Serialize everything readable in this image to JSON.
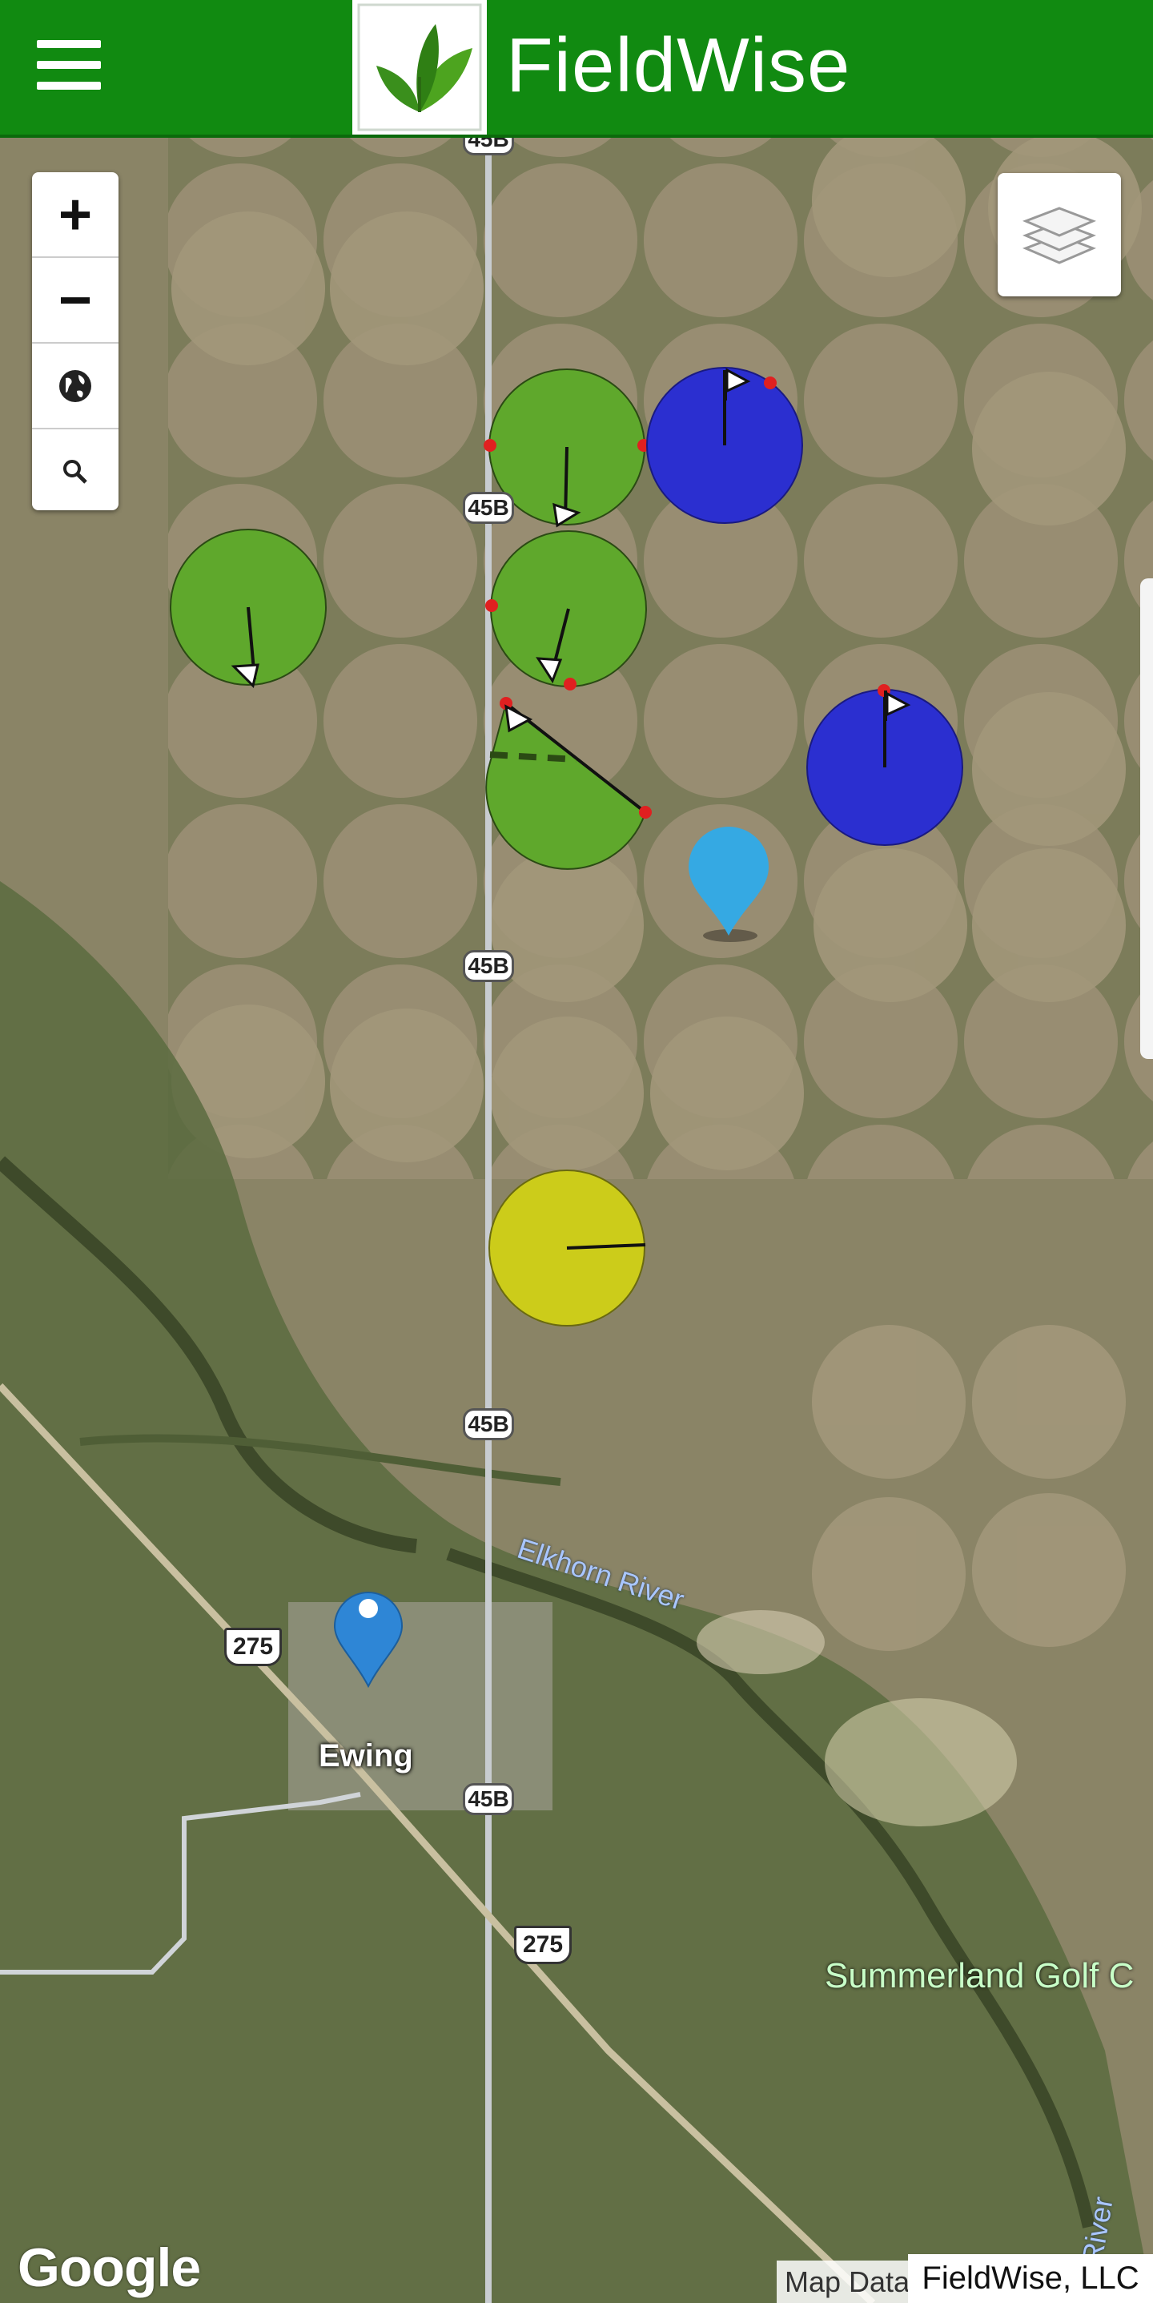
{
  "app": {
    "title": "FieldWise"
  },
  "map": {
    "zoom_in_label": "+",
    "zoom_out_label": "−",
    "labels": {
      "town": "Ewing",
      "river": "Elkhorn River",
      "river2": "Elkhorn River",
      "golf": "Summerland Golf C"
    },
    "road_shields": {
      "r45b_1": "45B",
      "r45b_2": "45B",
      "r45b_3": "45B",
      "r45b_4": "45B",
      "r45b_5": "45B",
      "us275_1": "275",
      "us275_2": "275"
    },
    "attribution": "Map Data",
    "brand": "FieldWise, LLC",
    "google": "Google"
  },
  "colors": {
    "header": "#118a11",
    "pivot_green": "#5fa82c",
    "pivot_blue": "#2b2fd0",
    "pivot_yellow": "#cccc1a",
    "marker_light_blue": "#35a9e3",
    "marker_blue": "#2e86d6"
  },
  "icons": [
    "menu-icon",
    "fieldwise-leaf-logo",
    "globe-icon",
    "search-icon",
    "layers-icon",
    "map-pin-icon",
    "flag-icon"
  ]
}
